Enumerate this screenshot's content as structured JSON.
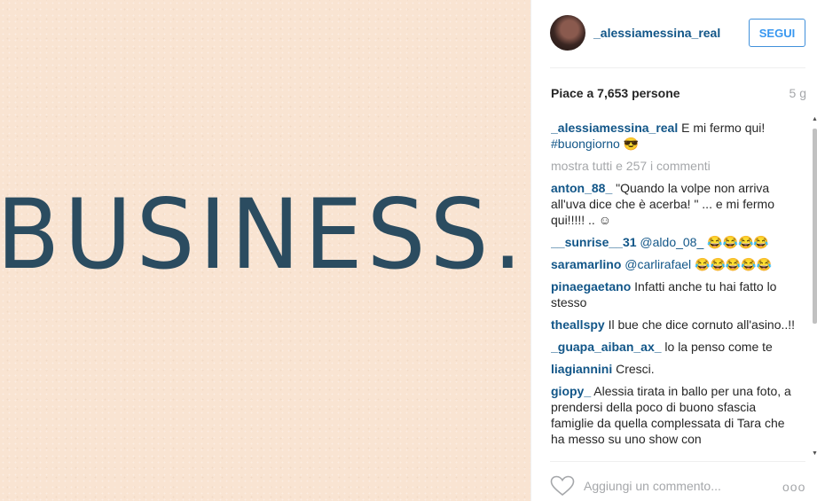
{
  "photo": {
    "text": "BUSINESS."
  },
  "header": {
    "username": "_alessiamessina_real",
    "follow_label": "SEGUI"
  },
  "stats": {
    "likes": "Piace a 7,653 persone",
    "time": "5 g"
  },
  "caption": {
    "user": "_alessiamessina_real",
    "text": " E mi fermo qui!",
    "hashtag": "#buongiorno",
    "emoji": " 😎"
  },
  "show_all": "mostra tutti e 257 i commenti",
  "comments": [
    {
      "user": "anton_88_",
      "tag": "",
      "text": " \"Quando la volpe non arriva all'uva dice che è acerba! \" ... e mi fermo qui!!!!! .. ☺"
    },
    {
      "user": "__sunrise__31",
      "tag": " @aldo_08_",
      "text": " 😂😂😂😂"
    },
    {
      "user": "saramarlino",
      "tag": " @carlirafael",
      "text": " 😂😂😂😂😂"
    },
    {
      "user": "pinaegaetano",
      "tag": "",
      "text": " Infatti anche tu hai fatto lo stesso"
    },
    {
      "user": "theallspy",
      "tag": "",
      "text": " Il bue che dice cornuto all'asino..!!"
    },
    {
      "user": "_guapa_aiban_ax_",
      "tag": "",
      "text": " lo la penso come te"
    },
    {
      "user": "liagiannini",
      "tag": "",
      "text": " Cresci."
    },
    {
      "user": "giopy_",
      "tag": "",
      "text": " Alessia tirata in ballo per una foto, a prendersi della poco di buono sfascia famiglie da quella complessata di Tara che ha messo su uno show con"
    }
  ],
  "footer": {
    "comment_placeholder": "Aggiungi un commento...",
    "more": "ooo"
  },
  "colors": {
    "link": "#125688",
    "button": "#3897f0",
    "muted": "#a5a7aa",
    "photo_bg": "#f9e4d2",
    "photo_text": "#2b4c60"
  },
  "icons": {
    "heart": "heart-icon",
    "more": "more-options-icon"
  }
}
